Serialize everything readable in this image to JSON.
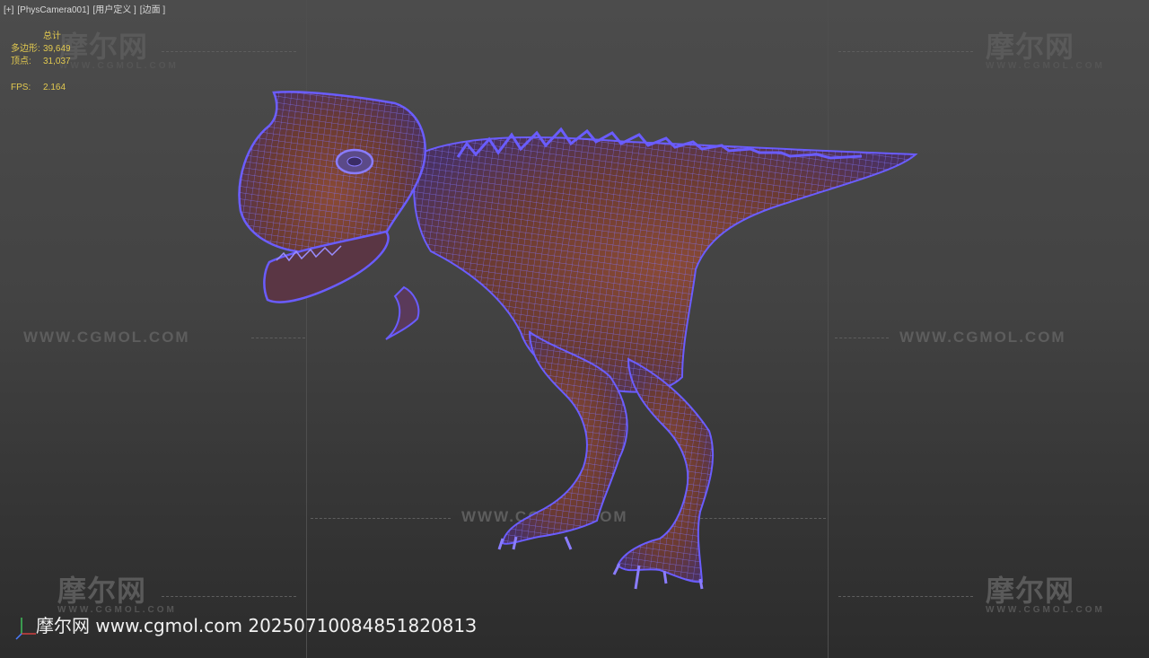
{
  "viewport": {
    "header_items": [
      "[+]",
      "[PhysCamera001]",
      "[用户定义 ]",
      "[边面 ]"
    ],
    "stats": {
      "total_label": "总计",
      "polygons_label": "多边形:",
      "polygons_value": "39,649",
      "vertices_label": "顶点:",
      "vertices_value": "31,037",
      "fps_label": "FPS:",
      "fps_value": "2.164"
    }
  },
  "watermark": {
    "logo_text": "摩尔网",
    "logo_sub": "WWW.CGMOL.COM",
    "url_text": "WWW.CGMOL.COM",
    "center_url": "WWW.CGMOL.COM"
  },
  "footer": {
    "caption": "摩尔网 www.cgmol.com 2025071008485182081З"
  },
  "colors": {
    "wire": "#6a5cff",
    "body_fill": "#6e3c30",
    "stats_text": "#e2c94f"
  },
  "icons": {
    "axis": "axis-gizmo-icon"
  }
}
